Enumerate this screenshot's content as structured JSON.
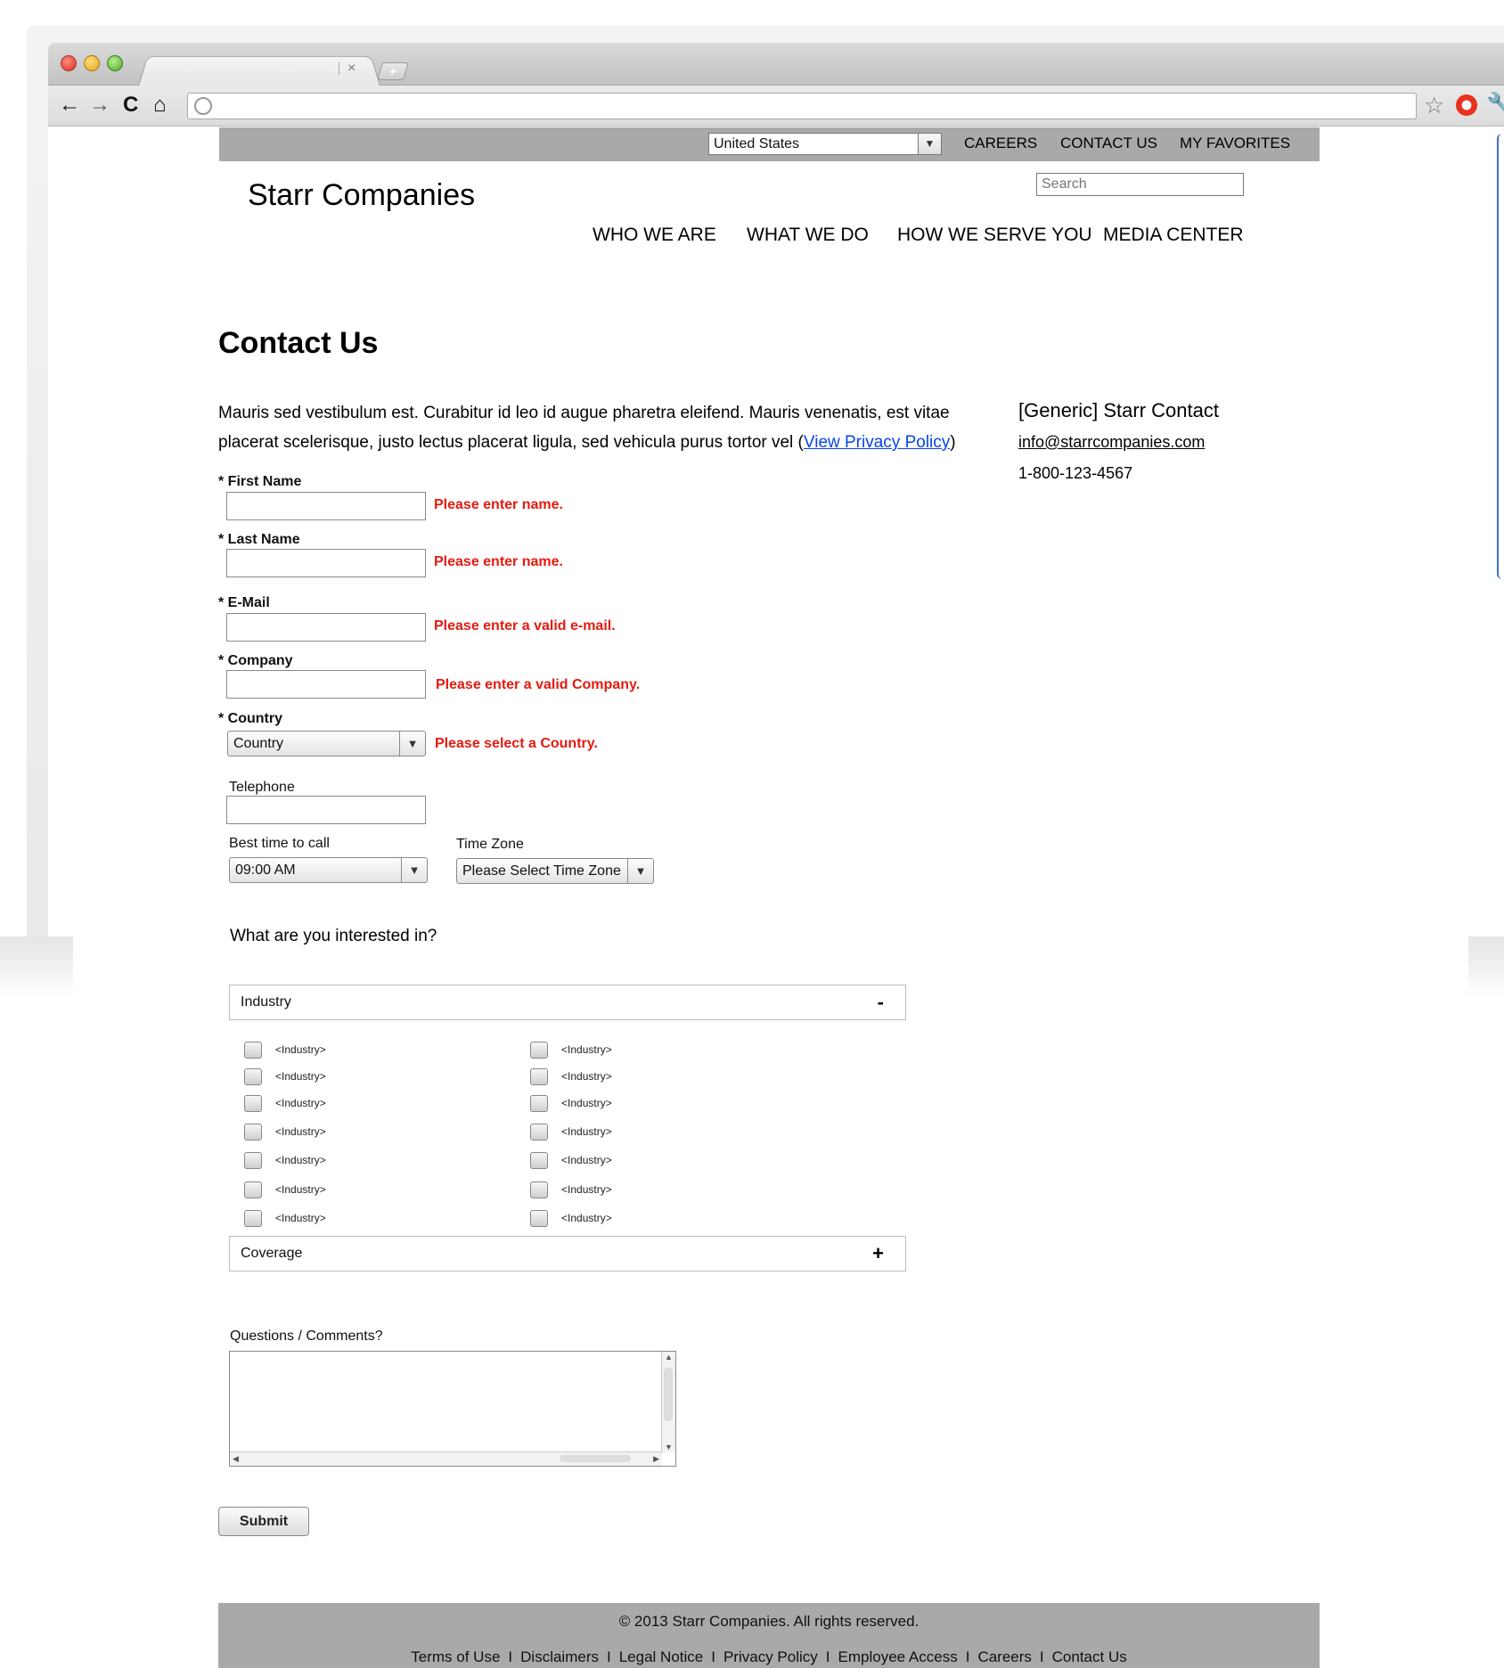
{
  "site": {
    "country_selector": "United States",
    "util_links": [
      "CAREERS",
      "CONTACT US",
      "MY FAVORITES"
    ],
    "brand": "Starr Companies",
    "search_placeholder": "Search",
    "main_nav": [
      "WHO WE ARE",
      "WHAT WE DO",
      "HOW WE SERVE YOU",
      "MEDIA CENTER"
    ]
  },
  "page": {
    "title": "Contact Us",
    "intro_text": "Mauris sed vestibulum est. Curabitur id leo id augue pharetra eleifend. Mauris venenatis, est vitae placerat scelerisque, justo lectus placerat ligula, sed vehicula purus tortor vel (",
    "privacy_link": "View Privacy Policy",
    "intro_close": ")"
  },
  "contact_card": {
    "name": "[Generic] Starr Contact",
    "email": "info@starrcompanies.com",
    "phone": "1-800-123-4567"
  },
  "form": {
    "first_name": {
      "label": "* First Name",
      "value": "",
      "error": "Please enter name."
    },
    "last_name": {
      "label": "* Last Name",
      "value": "",
      "error": "Please enter name."
    },
    "email": {
      "label": "* E-Mail",
      "value": "",
      "error": "Please enter a valid e-mail."
    },
    "company": {
      "label": "* Company",
      "value": "",
      "error": "Please enter a valid Company."
    },
    "country": {
      "label": "* Country",
      "selected": "Country",
      "error": "Please select a Country."
    },
    "telephone": {
      "label": "Telephone",
      "value": ""
    },
    "best_time": {
      "label": "Best time to call",
      "selected": "09:00 AM"
    },
    "time_zone": {
      "label": "Time Zone",
      "selected": "Please Select Time Zone"
    },
    "interest_question": "What are you interested in?",
    "industry_section": {
      "label": "Industry",
      "toggle": "-"
    },
    "industry_items": [
      "<Industry>",
      "<Industry>",
      "<Industry>",
      "<Industry>",
      "<Industry>",
      "<Industry>",
      "<Industry>",
      "<Industry>",
      "<Industry>",
      "<Industry>",
      "<Industry>",
      "<Industry>",
      "<Industry>",
      "<Industry>"
    ],
    "coverage_section": {
      "label": "Coverage",
      "toggle": "+"
    },
    "comments": {
      "label": "Questions / Comments?",
      "value": ""
    },
    "submit_label": "Submit"
  },
  "footer": {
    "copyright": "© 2013 Starr Companies. All rights reserved.",
    "links": [
      "Terms of Use",
      "Disclaimers",
      "Legal Notice",
      "Privacy Policy",
      "Employee Access",
      "Careers",
      "Contact Us"
    ],
    "separator": "I"
  },
  "browser": {
    "tab_close": "×",
    "new_tab": "+",
    "nav_back": "←",
    "nav_forward": "→",
    "nav_reload": "C",
    "nav_home": "⌂",
    "bookmark_star": "☆",
    "wrench": "🔧"
  }
}
